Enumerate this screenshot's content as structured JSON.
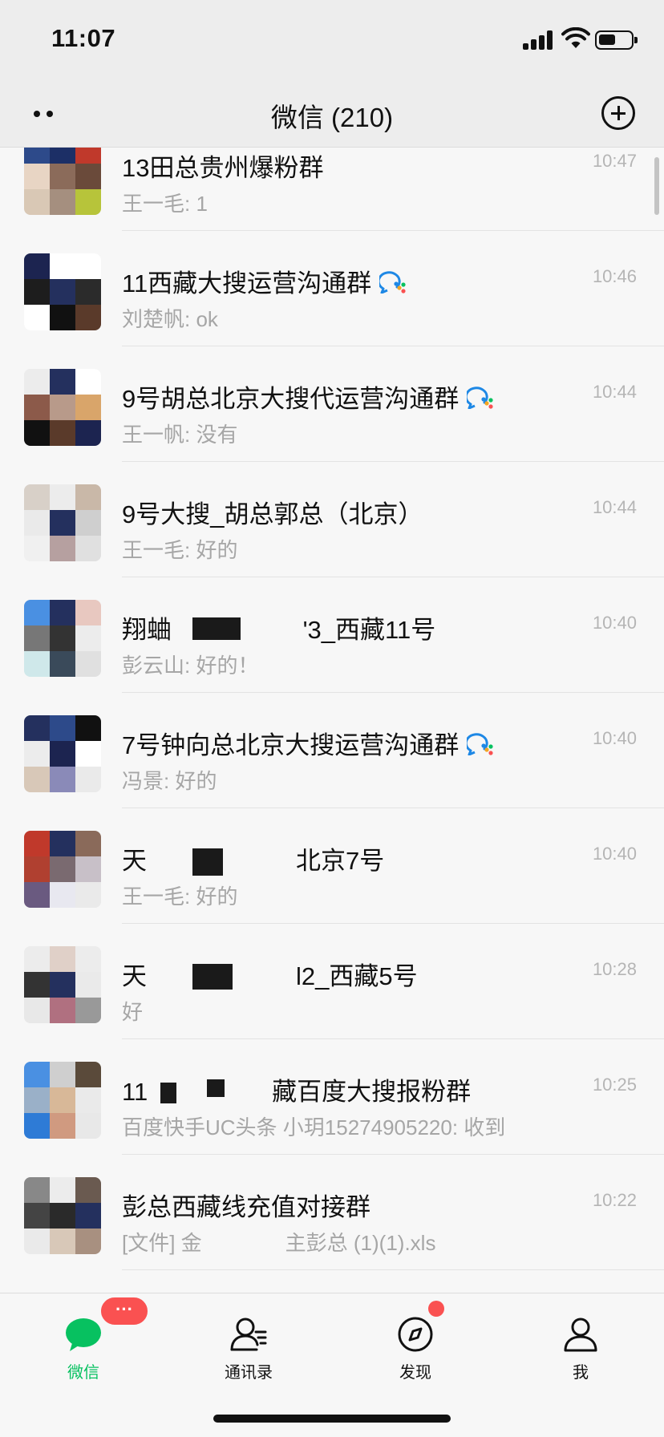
{
  "status_bar": {
    "time": "11:07"
  },
  "nav": {
    "title": "微信 (210)"
  },
  "chats": [
    {
      "name": "13田总贵州爆粉群",
      "preview": "王一毛: 1",
      "time": "10:47",
      "wecom": false
    },
    {
      "name": "11西藏大搜运营沟通群",
      "preview": "刘楚帆: ok",
      "time": "10:46",
      "wecom": true
    },
    {
      "name": "9号胡总北京大搜代运营沟通群",
      "preview": "王一帆: 没有",
      "time": "10:44",
      "wecom": true
    },
    {
      "name": "9号大搜_胡总郭总（北京）",
      "preview": "王一毛: 好的",
      "time": "10:44",
      "wecom": false
    },
    {
      "name": "翔蛐 　　　　　'3_西藏11号",
      "preview": "彭云山: 好的！",
      "time": "10:40",
      "wecom": false
    },
    {
      "name": "7号钟向总北京大搜运营沟通群",
      "preview": "冯景: 好的",
      "time": "10:40",
      "wecom": true
    },
    {
      "name": "天　　　　　　北京7号",
      "preview": "王一毛: 好的",
      "time": "10:40",
      "wecom": false
    },
    {
      "name": "天　　　　　　l2_西藏5号",
      "preview": "好",
      "time": "10:28",
      "wecom": false
    },
    {
      "name": "11　　　　　藏百度大搜报粉群",
      "preview": "百度快手UC头条  小玥15274905220: 收到",
      "time": "10:25",
      "wecom": false
    },
    {
      "name": "彭总西藏线充值对接群",
      "preview": "[文件] 金　　　　主彭总 (1)(1).xls",
      "time": "10:22",
      "wecom": false
    }
  ],
  "tabs": [
    {
      "label": "微信",
      "icon": "chat-bubble-icon",
      "active": true
    },
    {
      "label": "通讯录",
      "icon": "contacts-icon",
      "active": false
    },
    {
      "label": "发现",
      "icon": "compass-icon",
      "active": false
    },
    {
      "label": "我",
      "icon": "person-icon",
      "active": false
    }
  ],
  "badges": {
    "chats_badge": "···"
  },
  "colors": {
    "accent": "#07c160",
    "badge": "#fa5151",
    "wecom_blue": "#1e88e5"
  }
}
